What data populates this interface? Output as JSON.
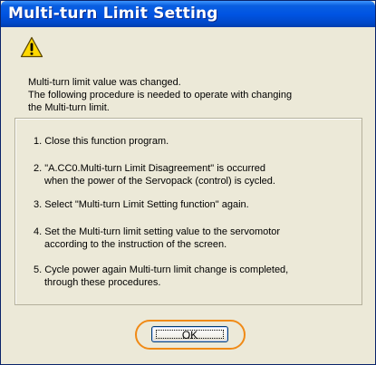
{
  "window": {
    "title": "Multi-turn Limit Setting"
  },
  "icon": "warning-icon",
  "message": {
    "line1": "Multi-turn limit value was changed.",
    "line2": "The following procedure is needed to operate with changing",
    "line3": "the Multi-turn limit."
  },
  "steps": [
    {
      "line1": "1. Close this function program.",
      "line2": ""
    },
    {
      "line1": "2. \"A.CC0.Multi-turn Limit Disagreement\" is occurred",
      "line2": "when the power of the Servopack (control) is cycled."
    },
    {
      "line1": "3. Select  \"Multi-turn Limit Setting function\" again.",
      "line2": ""
    },
    {
      "line1": "4. Set the Multi-turn limit setting value to the servomotor",
      "line2": "according to the instruction of the screen."
    },
    {
      "line1": "5. Cycle power again Multi-turn limit change is completed,",
      "line2": "through these procedures."
    }
  ],
  "buttons": {
    "ok_label": "OK"
  },
  "colors": {
    "titlebar": "#0054e3",
    "highlight": "#f08a16",
    "warning_fill": "#ffd800"
  }
}
